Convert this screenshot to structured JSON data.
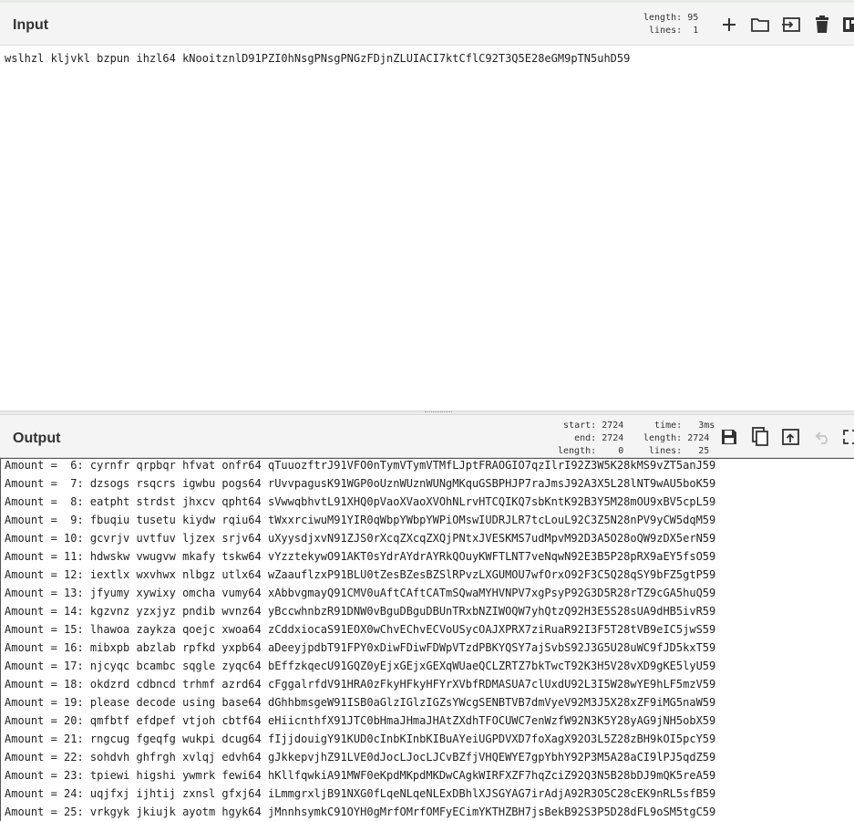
{
  "input": {
    "title": "Input",
    "stats": {
      "length_label": "length:",
      "length": "95",
      "lines_label": "lines:",
      "lines": "1"
    },
    "text": "wslhzl kljvkl bzpun ihzl64 kNooitznlD91PZI0hNsgPNsgPNGzFDjnZLUIACI7ktCflC92T3Q5E28eGM9pTN5uhD59",
    "icons": [
      "add-icon",
      "folder-icon",
      "import-icon",
      "trash-icon",
      "layout-icon"
    ]
  },
  "output": {
    "title": "Output",
    "stats": {
      "start_label": "start:",
      "start": "2724",
      "end_label": "end:",
      "end": "2724",
      "length_label": "length:",
      "length": "0",
      "time_label": "time:",
      "time": "3ms",
      "length2_label": "length:",
      "length2": "2724",
      "lines_label": "lines:",
      "lines": "25"
    },
    "icons": [
      "save-icon",
      "copy-icon",
      "replace-input-icon",
      "undo-icon",
      "maximise-icon"
    ],
    "lines": [
      "Amount =  6: cyrnfr qrpbqr hfvat onfr64 qTuuozftrJ91VFO0nTymVTymVTMfLJptFRAOGIO7qzIlrI92Z3W5K28kMS9vZT5anJ59",
      "Amount =  7: dzsogs rsqcrs igwbu pogs64 rUvvpagusK91WGP0oUznWUznWUNgMKquGSBPHJP7raJmsJ92A3X5L28lNT9wAU5boK59",
      "Amount =  8: eatpht strdst jhxcv qpht64 sVwwqbhvtL91XHQ0pVaoXVaoXVOhNLrvHTCQIKQ7sbKntK92B3Y5M28mOU9xBV5cpL59",
      "Amount =  9: fbuqiu tusetu kiydw rqiu64 tWxxrciwuM91YIR0qWbpYWbpYWPiOMswIUDRJLR7tcLouL92C3Z5N28nPV9yCW5dqM59",
      "Amount = 10: gcvrjv uvtfuv ljzex srjv64 uXyysdjxvN91ZJS0rXcqZXcqZXQjPNtxJVESKMS7udMpvM92D3A5O28oQW9zDX5erN59",
      "Amount = 11: hdwskw vwugvw mkafy tskw64 vYzztekywO91AKT0sYdrAYdrAYRkQOuyKWFTLNT7veNqwN92E3B5P28pRX9aEY5fsO59",
      "Amount = 12: iextlx wxvhwx nlbgz utlx64 wZaauflzxP91BLU0tZesBZesBZSlRPvzLXGUMOU7wfOrxO92F3C5Q28qSY9bFZ5gtP59",
      "Amount = 13: jfyumy xywixy omcha vumy64 xAbbvgmayQ91CMV0uAftCAftCATmSQwaMYHVNPV7xgPsyP92G3D5R28rTZ9cGA5huQ59",
      "Amount = 14: kgzvnz yzxjyz pndib wvnz64 yBccwhnbzR91DNW0vBguDBguDBUnTRxbNZIWOQW7yhQtzQ92H3E5S28sUA9dHB5ivR59",
      "Amount = 15: lhawoa zaykza qoejc xwoa64 zCddxiocaS91EOX0wChvEChvECVoUSycOAJXPRX7ziRuaR92I3F5T28tVB9eIC5jwS59",
      "Amount = 16: mibxpb abzlab rpfkd yxpb64 aDeeyjpdbT91FPY0xDiwFDiwFDWpVTzdPBKYQSY7ajSvbS92J3G5U28uWC9fJD5kxT59",
      "Amount = 17: njcyqc bcambc sqgle zyqc64 bEffzkqecU91GQZ0yEjxGEjxGEXqWUaeQCLZRTZ7bkTwcT92K3H5V28vXD9gKE5lyU59",
      "Amount = 18: okdzrd cdbncd trhmf azrd64 cFggalrfdV91HRA0zFkyHFkyHFYrXVbfRDMASUA7clUxdU92L3I5W28wYE9hLF5mzV59",
      "Amount = 19: please decode using base64 dGhhbmsgeW91ISB0aGlzIGlzIGZsYWcgSENBTVB7dmVyeV92M3J5X28xZF9iMG5naW59",
      "Amount = 20: qmfbtf efdpef vtjoh cbtf64 eHiicnthfX91JTC0bHmaJHmaJHAtZXdhTFOCUWC7enWzfW92N3K5Y28yAG9jNH5obX59",
      "Amount = 21: rngcug fgeqfg wukpi dcug64 fIjjdouigY91KUD0cInbKInbKIBuAYeiUGPDVXD7foXagX92O3L5Z28zBH9kOI5pcY59",
      "Amount = 22: sohdvh ghfrgh xvlqj edvh64 gJkkepvjhZ91LVE0dJocLJocLJCvBZfjVHQEWYE7gpYbhY92P3M5A28aCI9lPJ5qdZ59",
      "Amount = 23: tpiewi higshi ywmrk fewi64 hKllfqwkiA91MWF0eKpdMKpdMKDwCAgkWIRFXZF7hqZciZ92Q3N5B28bDJ9mQK5reA59",
      "Amount = 24: uqjfxj ijhtij zxnsl gfxj64 iLmmgrxljB91NXG0fLqeNLqeNLExDBhlXJSGYAG7irAdjA92R3O5C28cEK9nRL5sfB59",
      "Amount = 25: vrkgyk jkiujk ayotm hgyk64 jMnnhsymkC91OYH0gMrfOMrfOMFyECimYKTHZBH7jsBekB92S3P5D28dFL9oSM5tgC59"
    ]
  }
}
